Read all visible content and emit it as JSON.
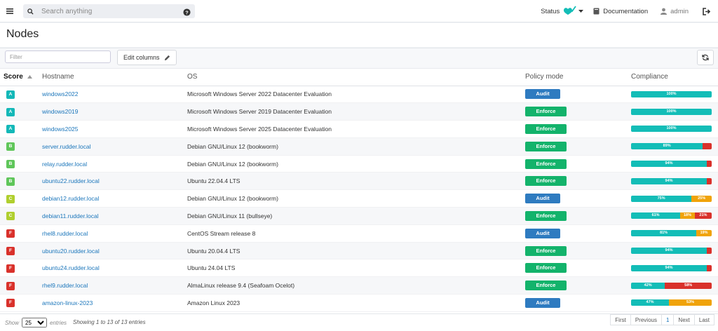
{
  "topbar": {
    "search_placeholder": "Search anything",
    "status_label": "Status",
    "documentation_label": "Documentation",
    "user_label": "admin"
  },
  "page": {
    "title": "Nodes"
  },
  "toolbar": {
    "filter_placeholder": "Filter",
    "edit_columns_label": "Edit columns"
  },
  "table": {
    "headers": {
      "score": "Score",
      "hostname": "Hostname",
      "os": "OS",
      "policy_mode": "Policy mode",
      "compliance": "Compliance"
    },
    "rows": [
      {
        "score": "A",
        "score_color": "#13b8b8",
        "hostname": "windows2022",
        "os": "Microsoft Windows Server 2022 Datacenter Evaluation",
        "mode": "Audit",
        "compliance": [
          {
            "label": "100%",
            "value": 100,
            "color": "#13bdb7"
          }
        ]
      },
      {
        "score": "A",
        "score_color": "#13b8b8",
        "hostname": "windows2019",
        "os": "Microsoft Windows Server 2019 Datacenter Evaluation",
        "mode": "Enforce",
        "compliance": [
          {
            "label": "100%",
            "value": 100,
            "color": "#13bdb7"
          }
        ]
      },
      {
        "score": "A",
        "score_color": "#13b8b8",
        "hostname": "windows2025",
        "os": "Microsoft Windows Server 2025 Datacenter Evaluation",
        "mode": "Enforce",
        "compliance": [
          {
            "label": "100%",
            "value": 100,
            "color": "#13bdb7"
          }
        ]
      },
      {
        "score": "B",
        "score_color": "#5fc65a",
        "hostname": "server.rudder.local",
        "os": "Debian GNU/Linux 12 (bookworm)",
        "mode": "Enforce",
        "compliance": [
          {
            "label": "89%",
            "value": 89,
            "color": "#13bdb7"
          },
          {
            "label": "",
            "value": 11,
            "color": "#d9312b"
          }
        ]
      },
      {
        "score": "B",
        "score_color": "#5fc65a",
        "hostname": "relay.rudder.local",
        "os": "Debian GNU/Linux 12 (bookworm)",
        "mode": "Enforce",
        "compliance": [
          {
            "label": "94%",
            "value": 94,
            "color": "#13bdb7"
          },
          {
            "label": "",
            "value": 6,
            "color": "#d9312b"
          }
        ]
      },
      {
        "score": "B",
        "score_color": "#5fc65a",
        "hostname": "ubuntu22.rudder.local",
        "os": "Ubuntu 22.04.4 LTS",
        "mode": "Enforce",
        "compliance": [
          {
            "label": "94%",
            "value": 94,
            "color": "#13bdb7"
          },
          {
            "label": "",
            "value": 6,
            "color": "#d9312b"
          }
        ]
      },
      {
        "score": "C",
        "score_color": "#b0cf2e",
        "hostname": "debian12.rudder.local",
        "os": "Debian GNU/Linux 12 (bookworm)",
        "mode": "Audit",
        "compliance": [
          {
            "label": "75%",
            "value": 75,
            "color": "#13bdb7"
          },
          {
            "label": "25%",
            "value": 25,
            "color": "#f0a30a"
          }
        ]
      },
      {
        "score": "C",
        "score_color": "#b0cf2e",
        "hostname": "debian11.rudder.local",
        "os": "Debian GNU/Linux 11 (bullseye)",
        "mode": "Enforce",
        "compliance": [
          {
            "label": "61%",
            "value": 61,
            "color": "#13bdb7"
          },
          {
            "label": "18%",
            "value": 18,
            "color": "#f0a30a"
          },
          {
            "label": "21%",
            "value": 21,
            "color": "#d9312b"
          }
        ]
      },
      {
        "score": "F",
        "score_color": "#d9312b",
        "hostname": "rhel8.rudder.local",
        "os": "CentOS Stream release 8",
        "mode": "Audit",
        "compliance": [
          {
            "label": "81%",
            "value": 81,
            "color": "#13bdb7"
          },
          {
            "label": "19%",
            "value": 19,
            "color": "#f0a30a"
          }
        ]
      },
      {
        "score": "F",
        "score_color": "#d9312b",
        "hostname": "ubuntu20.rudder.local",
        "os": "Ubuntu 20.04.4 LTS",
        "mode": "Enforce",
        "compliance": [
          {
            "label": "94%",
            "value": 94,
            "color": "#13bdb7"
          },
          {
            "label": "",
            "value": 6,
            "color": "#d9312b"
          }
        ]
      },
      {
        "score": "F",
        "score_color": "#d9312b",
        "hostname": "ubuntu24.rudder.local",
        "os": "Ubuntu 24.04 LTS",
        "mode": "Enforce",
        "compliance": [
          {
            "label": "94%",
            "value": 94,
            "color": "#13bdb7"
          },
          {
            "label": "",
            "value": 6,
            "color": "#d9312b"
          }
        ]
      },
      {
        "score": "F",
        "score_color": "#d9312b",
        "hostname": "rhel9.rudder.local",
        "os": "AlmaLinux release 9.4 (Seafoam Ocelot)",
        "mode": "Enforce",
        "compliance": [
          {
            "label": "42%",
            "value": 42,
            "color": "#13bdb7"
          },
          {
            "label": "58%",
            "value": 58,
            "color": "#d9312b"
          }
        ]
      },
      {
        "score": "F",
        "score_color": "#d9312b",
        "hostname": "amazon-linux-2023",
        "os": "Amazon Linux 2023",
        "mode": "Audit",
        "compliance": [
          {
            "label": "47%",
            "value": 47,
            "color": "#13bdb7"
          },
          {
            "label": "53%",
            "value": 53,
            "color": "#f0a30a"
          }
        ]
      }
    ]
  },
  "footer": {
    "show_label": "Show",
    "page_size": "25",
    "entries_label": "entries",
    "info": "Showing 1 to 13 of 13 entries",
    "pager": {
      "first": "First",
      "previous": "Previous",
      "current": "1",
      "next": "Next",
      "last": "Last"
    }
  }
}
